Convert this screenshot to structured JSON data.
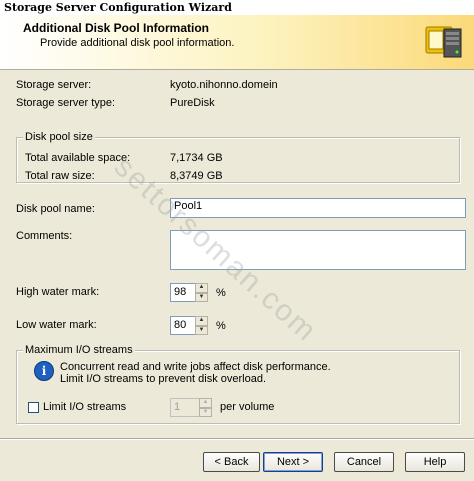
{
  "window": {
    "title": "Storage Server Configuration Wizard"
  },
  "header": {
    "title": "Additional Disk Pool Information",
    "subtitle": "Provide additional disk pool information."
  },
  "info": {
    "storage_server_label": "Storage server:",
    "storage_server_value": "kyoto.nihonno.domein",
    "storage_server_type_label": "Storage server type:",
    "storage_server_type_value": "PureDisk"
  },
  "disk_pool_size": {
    "legend": "Disk pool size",
    "available_label": "Total available space:",
    "available_value": "7,1734 GB",
    "raw_label": "Total raw size:",
    "raw_value": "8,3749 GB"
  },
  "form": {
    "name_label": "Disk pool name:",
    "name_value": "Pool1",
    "comments_label": "Comments:",
    "comments_value": "",
    "high_label": "High water mark:",
    "high_value": "98",
    "low_label": "Low water mark:",
    "low_value": "80",
    "percent": "%"
  },
  "io": {
    "legend": "Maximum I/O streams",
    "info_line1": "Concurrent read and write jobs affect disk performance.",
    "info_line2": "Limit I/O streams to prevent disk overload.",
    "limit_label": "Limit I/O streams",
    "limit_value": "1",
    "per_volume": "per volume"
  },
  "buttons": {
    "back": "< Back",
    "next": "Next >",
    "cancel": "Cancel",
    "help": "Help"
  },
  "watermark": "settorsoman.com"
}
